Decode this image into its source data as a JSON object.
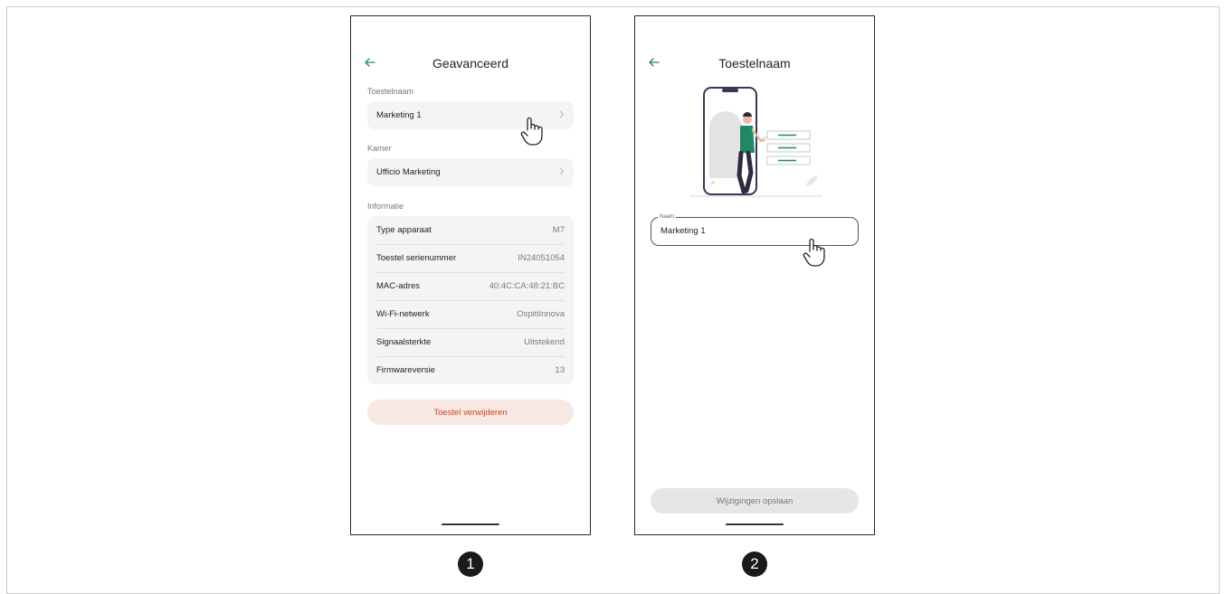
{
  "screen1": {
    "title": "Geavanceerd",
    "device_name_section": "Toestelnaam",
    "device_name": "Marketing 1",
    "room_section": "Kamer",
    "room_name": "Ufficio Marketing",
    "info_section": "Informatie",
    "info_rows": [
      {
        "label": "Type apparaat",
        "value": "M7"
      },
      {
        "label": "Toestel serienummer",
        "value": "IN24051054"
      },
      {
        "label": "MAC-adres",
        "value": "40:4C:CA:48:21:BC"
      },
      {
        "label": "Wi-Fi-netwerk",
        "value": "OspitiInnova"
      },
      {
        "label": "Signaalsterkte",
        "value": "Uitstekend"
      },
      {
        "label": "Firmwareversie",
        "value": "13"
      }
    ],
    "delete_button": "Toestel verwijderen"
  },
  "screen2": {
    "title": "Toestelnaam",
    "field_label": "Naam",
    "field_value": "Marketing 1",
    "save_button": "Wijzigingen opslaan"
  },
  "steps": [
    "1",
    "2"
  ],
  "icons": {
    "back": "arrow-left-icon",
    "chevron": "chevron-right-icon",
    "pointer": "hand-pointer-icon"
  },
  "colors": {
    "accent": "#1e8a63",
    "danger": "#d4421e",
    "danger_bg": "#f8e8e4"
  }
}
